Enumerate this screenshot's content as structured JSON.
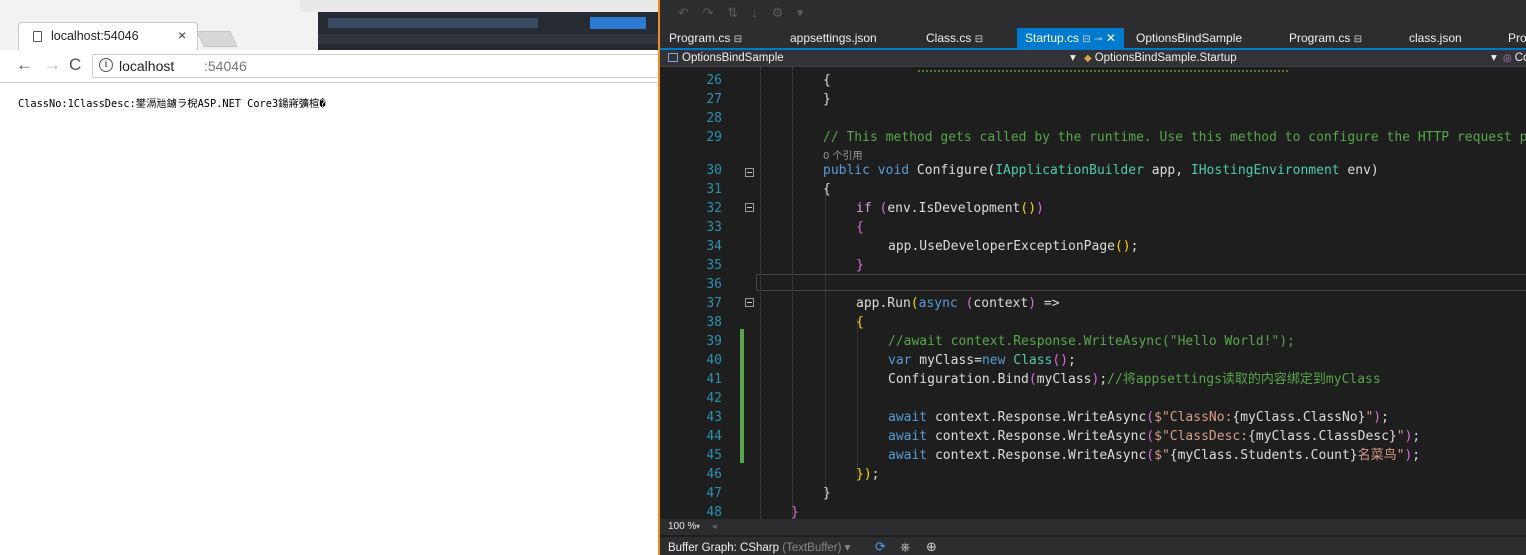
{
  "browser": {
    "tab_title": "localhost:54046",
    "tab_close": "×",
    "url_host": "localhost",
    "url_port": ":54046",
    "page_text": "ClassNo:1ClassDesc:鐢滆兘鐪ラ棿ASP.NET Core3鍚嶈彍楦�"
  },
  "vs": {
    "tabs": [
      {
        "label": "Program.cs",
        "pinned": true
      },
      {
        "label": "appsettings.json",
        "pinned": false
      },
      {
        "label": "Class.cs",
        "pinned": true
      },
      {
        "label": "Startup.cs",
        "pinned": true,
        "active": true
      },
      {
        "label": "OptionsBindSample",
        "pinned": false
      },
      {
        "label": "Program.cs",
        "pinned": true
      },
      {
        "label": "class.json",
        "pinned": false
      },
      {
        "label": "Pro",
        "pinned": false
      }
    ],
    "nav_project": "OptionsBindSample",
    "nav_class": "OptionsBindSample.Startup",
    "nav_member_clip": "Co",
    "codelens_refs": "0 个引用",
    "code_lines": [
      {
        "num": "26",
        "text": "{"
      },
      {
        "num": "27",
        "text": "}"
      },
      {
        "num": "28",
        "text": ""
      },
      {
        "num": "29",
        "text": "// This method gets called by the runtime. Use this method to configure the HTTP request pipeline."
      },
      {
        "num": "30",
        "text": "public void Configure(IApplicationBuilder app, IHostingEnvironment env)"
      },
      {
        "num": "31",
        "text": "{"
      },
      {
        "num": "32",
        "text": "if (env.IsDevelopment())"
      },
      {
        "num": "33",
        "text": "{"
      },
      {
        "num": "34",
        "text": "app.UseDeveloperExceptionPage();"
      },
      {
        "num": "35",
        "text": "}"
      },
      {
        "num": "36",
        "text": ""
      },
      {
        "num": "37",
        "text": "app.Run(async (context) =>"
      },
      {
        "num": "38",
        "text": "{"
      },
      {
        "num": "39",
        "text": "//await context.Response.WriteAsync(\"Hello World!\");"
      },
      {
        "num": "40",
        "text": "var myClass=new Class();"
      },
      {
        "num": "41",
        "text": "Configuration.Bind(myClass);//将appsettings读取的内容绑定到myClass"
      },
      {
        "num": "42",
        "text": ""
      },
      {
        "num": "43",
        "text": "await context.Response.WriteAsync($\"ClassNo:{myClass.ClassNo}\");"
      },
      {
        "num": "44",
        "text": "await context.Response.WriteAsync($\"ClassDesc:{myClass.ClassDesc}\");"
      },
      {
        "num": "45",
        "text": "await context.Response.WriteAsync($\"{myClass.Students.Count}名菜鸟\");"
      },
      {
        "num": "46",
        "text": "});"
      },
      {
        "num": "47",
        "text": "}"
      },
      {
        "num": "48",
        "text": "}"
      }
    ],
    "zoom_level": "100 %",
    "status": {
      "buffer_graph_label": "Buffer Graph:",
      "buffer_graph_value": "CSharp",
      "buffer_graph_note": "(TextBuffer)"
    }
  }
}
